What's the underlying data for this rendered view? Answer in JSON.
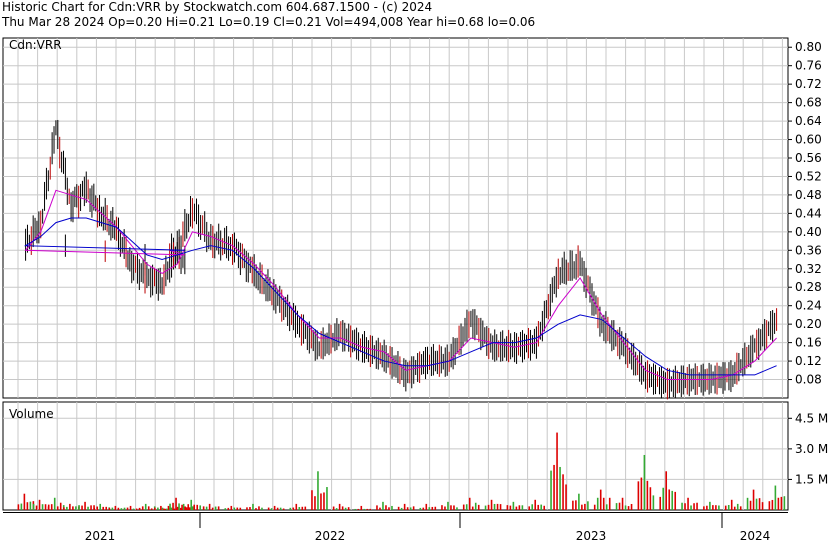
{
  "header": {
    "line1": "Historic Chart for Cdn:VRR by Stockwatch.com 604.687.1500 - (c) 2024",
    "line2": "Thu Mar 28 2024   Op=0.20  Hi=0.21  Lo=0.19  Cl=0.21  Vol=494,008  Year hi=0.68  lo=0.06"
  },
  "colors": {
    "price": "#000000",
    "ma_short": "#cc00cc",
    "ma_long": "#0000cc",
    "vol_up": "#33aa33",
    "vol_down": "#dd0000",
    "grid": "#c8c8c8"
  },
  "chart_data": [
    {
      "type": "line",
      "ylabel": "Cdn:VRR",
      "y_ticks": [
        "0.80",
        "0.76",
        "0.72",
        "0.68",
        "0.64",
        "0.60",
        "0.56",
        "0.52",
        "0.48",
        "0.44",
        "0.40",
        "0.36",
        "0.32",
        "0.28",
        "0.24",
        "0.20",
        "0.16",
        "0.12",
        "0.08"
      ],
      "ylim": [
        0.04,
        0.82
      ],
      "x_labels": [
        "2021",
        "2022",
        "2023",
        "2024"
      ],
      "x": [
        "2020-11",
        "2020-12",
        "2021-01",
        "2021-02",
        "2021-03",
        "2021-04",
        "2021-05",
        "2021-06",
        "2021-07",
        "2021-08",
        "2021-09",
        "2021-10",
        "2021-11",
        "2021-12",
        "2022-01",
        "2022-02",
        "2022-03",
        "2022-04",
        "2022-05",
        "2022-06",
        "2022-07",
        "2022-08",
        "2022-09",
        "2022-10",
        "2022-11",
        "2022-12",
        "2023-01",
        "2023-02",
        "2023-03",
        "2023-04",
        "2023-05",
        "2023-06",
        "2023-07",
        "2023-08",
        "2023-09",
        "2023-10",
        "2023-11",
        "2023-12",
        "2024-01",
        "2024-02",
        "2024-03"
      ],
      "series": [
        {
          "values": [
            0.36,
            0.34,
            0.37,
            0.42,
            0.62,
            0.46,
            0.49,
            0.44,
            0.4,
            0.33,
            0.3,
            0.29,
            0.36,
            0.45,
            0.38,
            0.37,
            0.31,
            0.26,
            0.2,
            0.15,
            0.18,
            0.15,
            0.13,
            0.09,
            0.12,
            0.12,
            0.21,
            0.15,
            0.15,
            0.16,
            0.31,
            0.33,
            0.2,
            0.15,
            0.09,
            0.07,
            0.08,
            0.08,
            0.09,
            0.15,
            0.21
          ]
        },
        {
          "values": [
            0.36,
            0.35,
            0.36,
            0.4,
            0.49,
            0.48,
            0.47,
            0.44,
            0.41,
            0.37,
            0.33,
            0.31,
            0.33,
            0.4,
            0.39,
            0.37,
            0.33,
            0.28,
            0.22,
            0.17,
            0.17,
            0.15,
            0.14,
            0.1,
            0.11,
            0.12,
            0.17,
            0.16,
            0.15,
            0.16,
            0.24,
            0.3,
            0.22,
            0.16,
            0.1,
            0.08,
            0.08,
            0.08,
            0.09,
            0.12,
            0.17
          ]
        },
        {
          "values": [
            0.36,
            0.36,
            0.37,
            0.39,
            0.42,
            0.43,
            0.43,
            0.42,
            0.41,
            0.38,
            0.35,
            0.34,
            0.35,
            0.36,
            0.37,
            0.36,
            0.32,
            0.27,
            0.22,
            0.18,
            0.16,
            0.14,
            0.12,
            0.11,
            0.11,
            0.12,
            0.14,
            0.16,
            0.16,
            0.17,
            0.2,
            0.22,
            0.21,
            0.17,
            0.13,
            0.1,
            0.09,
            0.09,
            0.09,
            0.09,
            0.11
          ]
        }
      ]
    },
    {
      "type": "bar",
      "ylabel": "Volume",
      "y_ticks": [
        "4.5 M",
        "3.0 M",
        "1.5 M"
      ],
      "ylim": [
        0,
        5.3
      ],
      "values_m": [
        0.2,
        0.3,
        0.8,
        0.5,
        0.6,
        0.3,
        0.4,
        0.3,
        0.2,
        0.2,
        0.3,
        0.2,
        0.6,
        0.5,
        0.3,
        0.2,
        0.3,
        0.2,
        0.3,
        1.9,
        0.3,
        0.2,
        0.4,
        0.3,
        0.3,
        0.4,
        0.6,
        0.5,
        0.4,
        0.5,
        3.8,
        0.8,
        1.0,
        0.6,
        2.7,
        1.9,
        0.6,
        0.4,
        0.5,
        1.0,
        1.2
      ]
    }
  ]
}
